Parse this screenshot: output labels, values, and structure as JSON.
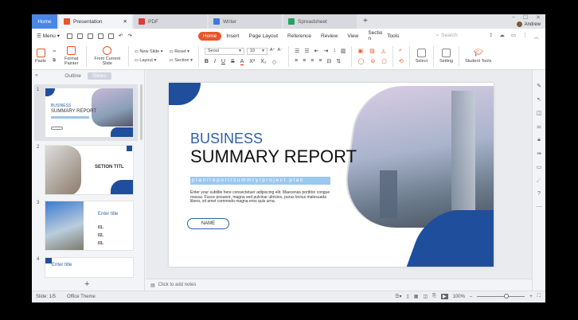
{
  "tabs": [
    {
      "label": "Home"
    },
    {
      "label": "Presentation",
      "color": "#e8562a"
    },
    {
      "label": "PDF",
      "color": "#e03a3a"
    },
    {
      "label": "Writer",
      "color": "#3a7ae0"
    },
    {
      "label": "Spreadsheet",
      "color": "#1fa463"
    }
  ],
  "user": "Andrew",
  "menu": {
    "label": "Menu",
    "items": [
      "Home",
      "Insert",
      "Page Layout",
      "Reference",
      "Review",
      "View",
      "Sectio n",
      "Tools"
    ],
    "search_placeholder": "Search"
  },
  "ribbon": {
    "paste": "Paste",
    "format_painter": "Format Painter",
    "from_current": "From Current Slide",
    "new_slide": "New Slide",
    "layout": "Layout",
    "reset": "Reset",
    "section": "Section",
    "font": "Seoui",
    "size": "10",
    "select": "Select",
    "setting": "Setting",
    "student_tools": "Student Tools"
  },
  "panel": {
    "outline": "Outline",
    "slides": "Slides"
  },
  "thumbs": [
    {
      "num": "1",
      "title1": "BUSINESS",
      "title2": "SUMMARY REPORT"
    },
    {
      "num": "2",
      "title": "SETION TITL"
    },
    {
      "num": "3",
      "title": "Enter title",
      "items": [
        "01.",
        "02.",
        "03."
      ]
    },
    {
      "num": "4",
      "title": "Enter title"
    }
  ],
  "slide": {
    "title1": "BUSINESS",
    "title2": "SUMMARY REPORT",
    "tagline": "plan/report/summry/project plan",
    "subtitle": "Enter your subtitle here consectetuer adipiscing elit. Maecenas porttitor congue massa. Fusce posuere, magna sed pulvinar ultricies, purus lectus malesuada libero, sit amet commodo magna eros quis urna.",
    "name": "NAME"
  },
  "notes": "Click to add notes",
  "status": {
    "slide": "Slide: 1/5",
    "theme": "Office Theme",
    "zoom": "100%"
  },
  "colors": {
    "accent": "#e8562a",
    "brand_blue": "#1f4e9c",
    "title_blue": "#2f5fa8"
  }
}
